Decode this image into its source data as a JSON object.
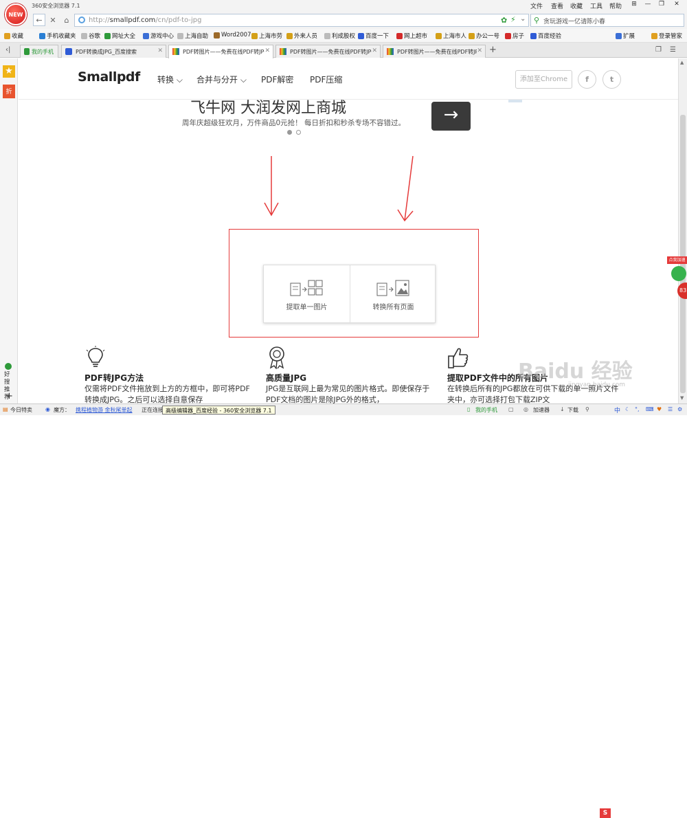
{
  "browser": {
    "logo_text": "NEW",
    "title": "360安全浏览器 7.1",
    "menu": [
      "文件",
      "查看",
      "收藏",
      "工具",
      "帮助"
    ],
    "window_buttons": [
      "⊞",
      "—",
      "❐",
      "✕"
    ],
    "url_scheme": "http://",
    "url_host": "smallpdf.com",
    "url_path": "/cn/pdf-to-jpg",
    "search_text": "贪玩游戏一亿请陈小春"
  },
  "bookmarks": [
    {
      "label": "收藏",
      "color": "#e0a020"
    },
    {
      "label": "手机收藏夹",
      "color": "#2a7fd4"
    },
    {
      "label": "谷歌",
      "color": "#bbbbbb"
    },
    {
      "label": "网址大全",
      "color": "#2e9a3a"
    },
    {
      "label": "游戏中心",
      "color": "#3b6fd6"
    },
    {
      "label": "上海自助",
      "color": "#bbbbbb"
    },
    {
      "label": "Word2007",
      "color": "#9c6a2a"
    },
    {
      "label": "上海市劳",
      "color": "#d4a017"
    },
    {
      "label": "外来人员",
      "color": "#d4a017"
    },
    {
      "label": "利成股权",
      "color": "#bbbbbb"
    },
    {
      "label": "百度一下",
      "color": "#2f5bd6"
    },
    {
      "label": "网上超市",
      "color": "#d42a2a"
    },
    {
      "label": "上海市人",
      "color": "#d4a017"
    },
    {
      "label": "办公一号",
      "color": "#d4a017"
    },
    {
      "label": "房子",
      "color": "#d42a2a"
    },
    {
      "label": "百度经验",
      "color": "#2f5bd6"
    },
    {
      "label": "扩展",
      "color": "#3b6fd6"
    },
    {
      "label": "登录管家",
      "color": "#e0a020"
    }
  ],
  "tabs": [
    {
      "label": "我的手机",
      "active": false
    },
    {
      "label": "PDF转换成JPG_百度搜索",
      "active": false
    },
    {
      "label": "PDF转图片——免费在线PDF转JPG",
      "active": true
    },
    {
      "label": "PDF转图片——免费在线PDF转JPG",
      "active": false
    },
    {
      "label": "PDF转图片——免费在线PDF转JPG",
      "active": false
    }
  ],
  "sidebar": {
    "coupon_label": "折",
    "hot_search_label": "好搜推荐"
  },
  "site": {
    "brand": "Smallpdf",
    "nav": [
      "转换 ⌵",
      "合并与分开 ⌵",
      "PDF解密",
      "PDF压缩"
    ],
    "chrome_button": "添加至Chrome",
    "social": [
      "f",
      "t"
    ]
  },
  "banner": {
    "title": "飞牛网 大润发网上商城",
    "subtitle": "周年庆超级狂欢月，万件商品0元抢！ 每日折扣和秒杀专场不容错过。",
    "next_arrow": "→"
  },
  "dropzone": {
    "options": [
      "提取单一图片",
      "转换所有页面"
    ]
  },
  "features": [
    {
      "title": "PDF转JPG方法",
      "text": "仅需将PDF文件拖放到上方的方框中，即可将PDF转换成JPG。之后可以选择自意保存"
    },
    {
      "title": "高质量JPG",
      "text": "JPG是互联网上最为常见的图片格式。即使保存于PDF文档的图片是除JPG外的格式，"
    },
    {
      "title": "提取PDF文件中的所有图片",
      "text": "在转换后所有的JPG都放在可供下载的单一照片文件夹中，亦可选择打包下载ZIP文"
    }
  ],
  "watermark": {
    "text": "Baidu 经验",
    "url": "jingyan.baidu.com"
  },
  "statusbar": {
    "today_deals": "今日特卖",
    "magic": "魔方：",
    "magic_link": "携程植物游 金秋尾单起",
    "status_text": "正在连接",
    "tooltip": "高级编辑器_百度经验 - 360安全浏览器 7.1",
    "my_phone": "我的手机",
    "accelerator": "加速器",
    "download": "下载",
    "ime": "中"
  },
  "float_badge": {
    "label": "点我加速",
    "value": "83"
  },
  "colors": {
    "accent_red": "#e53a3a",
    "browser_green": "#2e9a3a",
    "logo_red": "#d3181b"
  }
}
